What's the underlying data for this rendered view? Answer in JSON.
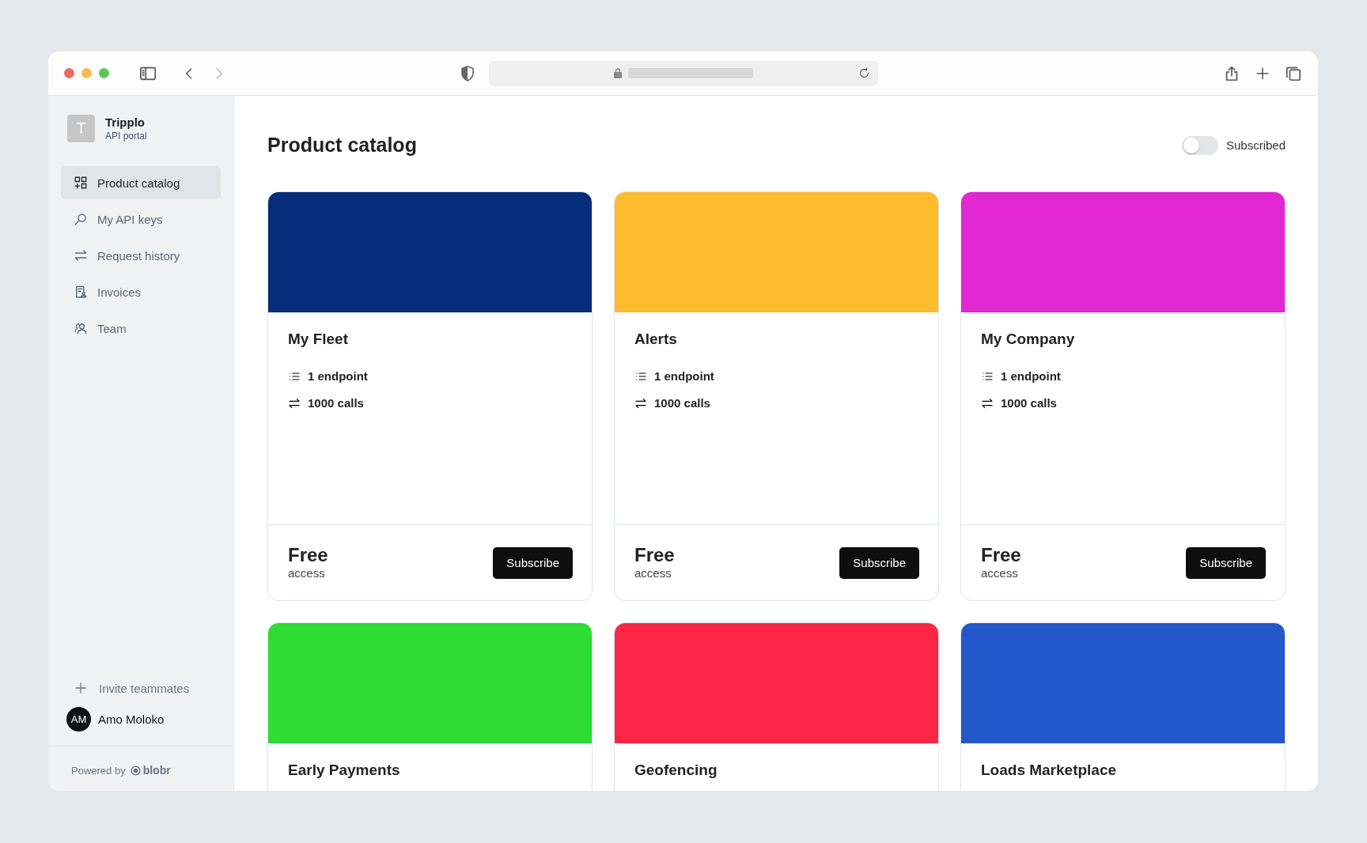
{
  "browser": {
    "back_enabled": true,
    "forward_enabled": false
  },
  "sidebar": {
    "org": {
      "initial": "T",
      "name": "Tripplo",
      "subtitle": "API portal"
    },
    "items": [
      {
        "label": "Product catalog",
        "kind": "grid",
        "selected": true
      },
      {
        "label": "My API keys",
        "kind": "key",
        "selected": false
      },
      {
        "label": "Request history",
        "kind": "arrows",
        "selected": false
      },
      {
        "label": "Invoices",
        "kind": "invoice",
        "selected": false
      },
      {
        "label": "Team",
        "kind": "team",
        "selected": false
      }
    ],
    "invite": "Invite teammates",
    "user": {
      "initials": "AM",
      "name": "Amo Moloko"
    },
    "powered_by": "Powered by",
    "brand": "blobr"
  },
  "main": {
    "title": "Product catalog",
    "filter": {
      "label": "Subscribed",
      "on": false
    },
    "products": [
      {
        "title": "My Fleet",
        "color": "#052d7a",
        "endpoints": "1 endpoint",
        "calls": "1000 calls",
        "price": "Free",
        "price_note": "access",
        "button": "Subscribe"
      },
      {
        "title": "Alerts",
        "color": "#fdbb30",
        "endpoints": "1 endpoint",
        "calls": "1000 calls",
        "price": "Free",
        "price_note": "access",
        "button": "Subscribe"
      },
      {
        "title": "My Company",
        "color": "#e027d2",
        "endpoints": "1 endpoint",
        "calls": "1000 calls",
        "price": "Free",
        "price_note": "access",
        "button": "Subscribe"
      },
      {
        "title": "Early Payments",
        "color": "#2edc33"
      },
      {
        "title": "Geofencing",
        "color": "#fb2646"
      },
      {
        "title": "Loads Marketplace",
        "color": "#2457c9"
      }
    ]
  }
}
